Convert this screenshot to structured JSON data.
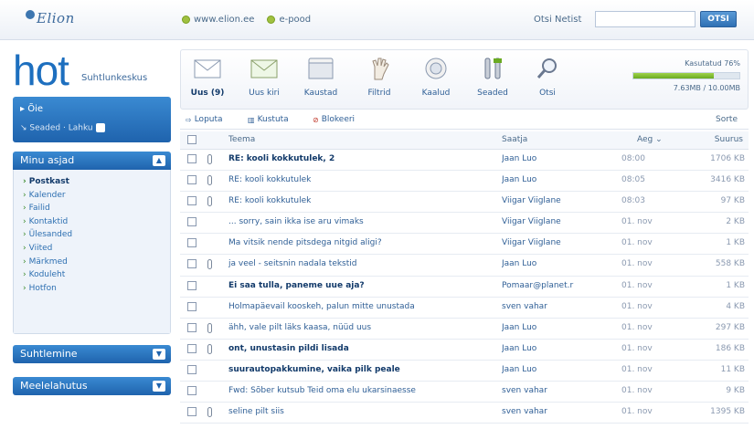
{
  "topbar": {
    "logo": "Elion",
    "links": [
      "www.elion.ee",
      "e-pood"
    ],
    "search_label": "Otsi Netist",
    "search_value": "",
    "search_button": "OTSI"
  },
  "brand": {
    "big": "hot",
    "sub": "Suhtlunkeskus"
  },
  "user": {
    "name": "Õie",
    "settings": "Seaded",
    "logout": "Lahku"
  },
  "panels": {
    "menu": {
      "title": "Minu asjad",
      "items": [
        "Postkast",
        "Kalender",
        "Failid",
        "Kontaktid",
        "Ülesanded",
        "Viited",
        "Märkmed",
        "Koduleht",
        "Hotfon"
      ]
    },
    "suhtlemine": {
      "title": "Suhtlemine"
    },
    "meelelahutus": {
      "title": "Meelelahutus"
    }
  },
  "toolbar": {
    "tools": [
      {
        "label": "Uus (9)",
        "icon": "envelope-icon"
      },
      {
        "label": "Uus kiri",
        "icon": "new-letter-icon"
      },
      {
        "label": "Kaustad",
        "icon": "folder-icon"
      },
      {
        "label": "Filtrid",
        "icon": "filter-hand-icon"
      },
      {
        "label": "Kaalud",
        "icon": "shield-icon"
      },
      {
        "label": "Seaded",
        "icon": "tools-icon"
      },
      {
        "label": "Otsi",
        "icon": "magnifier-icon"
      }
    ],
    "quota_label": "Kasutatud 76%",
    "quota_fraction": 0.76,
    "quota_value": "7.63MB / 10.00MB"
  },
  "actions": {
    "items": [
      "Loputa",
      "Kustuta",
      "Blokeeri"
    ],
    "sort_label": "Sorte"
  },
  "table": {
    "headers": {
      "subject": "Teema",
      "from": "Saatja",
      "date": "Aeg ⌄",
      "size": "Suurus"
    },
    "rows": [
      {
        "subject": "RE: kooli kokkutulek, 2",
        "from": "Jaan Luo",
        "date": "08:00",
        "size": "1706 KB",
        "attach": true,
        "unread": true
      },
      {
        "subject": "RE: kooli kokkutulek",
        "from": "Jaan Luo",
        "date": "08:05",
        "size": "3416 KB",
        "attach": true,
        "unread": false
      },
      {
        "subject": "RE: kooli kokkutulek",
        "from": "Viigar Viiglane",
        "date": "08:03",
        "size": "97 KB",
        "attach": true,
        "unread": false
      },
      {
        "subject": "... sorry, sain ikka ise aru vimaks",
        "from": "Viigar Viiglane",
        "date": "01. nov",
        "size": "2 KB",
        "attach": false,
        "unread": false
      },
      {
        "subject": "Ma vitsik nende pitsdega nitgid aligi?",
        "from": "Viigar Viiglane",
        "date": "01. nov",
        "size": "1 KB",
        "attach": false,
        "unread": false
      },
      {
        "subject": "ja veel - seitsnin nadala tekstid",
        "from": "Jaan Luo",
        "date": "01. nov",
        "size": "558 KB",
        "attach": true,
        "unread": false
      },
      {
        "subject": "Ei saa tulla, paneme uue aja?",
        "from": "Pomaar@planet.r",
        "date": "01. nov",
        "size": "1 KB",
        "attach": false,
        "unread": true
      },
      {
        "subject": "Holmapäevail kooskeh, palun mitte unustada",
        "from": "sven vahar",
        "date": "01. nov",
        "size": "4 KB",
        "attach": false,
        "unread": false
      },
      {
        "subject": "ähh, vale pilt läks kaasa, nüüd uus",
        "from": "Jaan Luo",
        "date": "01. nov",
        "size": "297 KB",
        "attach": true,
        "unread": false
      },
      {
        "subject": "ont, unustasin pildi lisada",
        "from": "Jaan Luo",
        "date": "01. nov",
        "size": "186 KB",
        "attach": true,
        "unread": true
      },
      {
        "subject": "suurautopakkumine, vaika pilk peale",
        "from": "Jaan Luo",
        "date": "01. nov",
        "size": "11 KB",
        "attach": false,
        "unread": true
      },
      {
        "subject": "Fwd: Sõber kutsub Teid oma elu ukarsinaesse",
        "from": "sven vahar",
        "date": "01. nov",
        "size": "9 KB",
        "attach": false,
        "unread": false
      },
      {
        "subject": "seline pilt siis",
        "from": "sven vahar",
        "date": "01. nov",
        "size": "1395 KB",
        "attach": true,
        "unread": false
      }
    ]
  }
}
